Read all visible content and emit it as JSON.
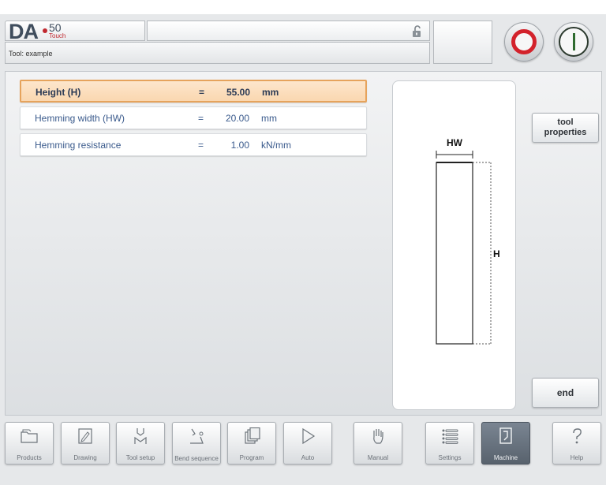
{
  "header": {
    "logo": {
      "brand": "DA",
      "model": "50",
      "variant": "Touch"
    },
    "title": "",
    "info_text": "Tool: example"
  },
  "icons": {
    "lock": "unlocked-padlock-icon",
    "stop": "stop-icon",
    "start": "start-icon"
  },
  "params": [
    {
      "label": "Height (H)",
      "eq": "=",
      "value": "55.00",
      "unit": "mm",
      "selected": true
    },
    {
      "label": "Hemming width (HW)",
      "eq": "=",
      "value": "20.00",
      "unit": "mm",
      "selected": false
    },
    {
      "label": "Hemming resistance",
      "eq": "=",
      "value": "1.00",
      "unit": "kN/mm",
      "selected": false
    }
  ],
  "preview": {
    "width_label": "HW",
    "height_label": "H"
  },
  "side_buttons": {
    "tool_properties_line1": "tool",
    "tool_properties_line2": "properties",
    "end": "end"
  },
  "nav": [
    {
      "label": "Products",
      "icon": "folder-icon"
    },
    {
      "label": "Drawing",
      "icon": "pencil-icon"
    },
    {
      "label": "Tool setup",
      "icon": "tool-setup-icon"
    },
    {
      "label": "Bend sequence",
      "icon": "bend-sequence-icon"
    },
    {
      "label": "Program",
      "icon": "program-icon"
    },
    {
      "label": "Auto",
      "icon": "play-icon"
    },
    {
      "label": "Manual",
      "icon": "hand-icon"
    },
    {
      "label": "Settings",
      "icon": "settings-list-icon"
    },
    {
      "label": "Machine",
      "icon": "machine-icon",
      "active": true
    },
    {
      "label": "Help",
      "icon": "help-icon"
    }
  ],
  "colors": {
    "accent_orange": "#e6a35c",
    "stop_red": "#d3222b",
    "start_green": "#2f6b2f",
    "label_blue": "#3a5a8c"
  }
}
